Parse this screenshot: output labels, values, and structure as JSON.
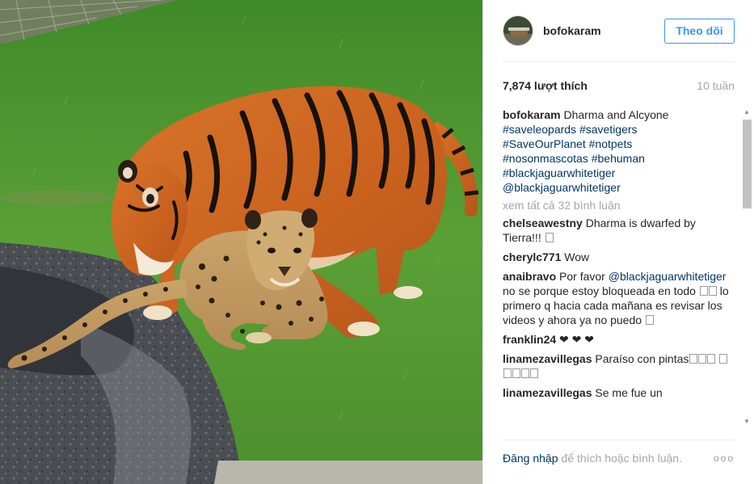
{
  "post": {
    "username": "bofokaram",
    "follow_label": "Theo dõi",
    "likes": "7,874 lượt thích",
    "age": "10 tuần",
    "caption": {
      "user": "bofokaram",
      "text": "Dharma and Alcyone",
      "tags": [
        "#saveleopards",
        "#savetigers",
        "#SaveOurPlanet",
        "#notpets",
        "#nosonmascotas",
        "#behuman",
        "#blackjaguarwhitetiger",
        "@blackjaguarwhitetiger"
      ]
    },
    "view_all": "xem tất cả 32 bình luận",
    "comments": [
      {
        "user": "chelseawestny",
        "text": "Dharma is dwarfed by Tierra!!!"
      },
      {
        "user": "cherylc771",
        "text": "Wow"
      },
      {
        "user": "anaibravo",
        "text_before": "Por favor",
        "mention": "@blackjaguarwhitetiger",
        "text_after": "no se porque estoy bloqueada en todo",
        "text_after2": "lo primero q hacia cada mañana es revisar los videos y ahora ya no puedo"
      },
      {
        "user": "franklin24",
        "text": "❤ ❤ ❤"
      },
      {
        "user": "linamezavillegas",
        "text": "Paraíso con pintas"
      },
      {
        "user": "linamezavillegas",
        "text": "Se me fue un"
      }
    ],
    "footer": {
      "login_link": "Đăng nhập",
      "text": "để thích hoặc bình luận.",
      "more": "ooo"
    },
    "icons": {
      "more": "more-options-icon",
      "avatar": "profile-avatar"
    },
    "colors": {
      "accent": "#3897f0",
      "link": "#003569",
      "muted": "#a5a7aa",
      "text": "#262626"
    }
  }
}
